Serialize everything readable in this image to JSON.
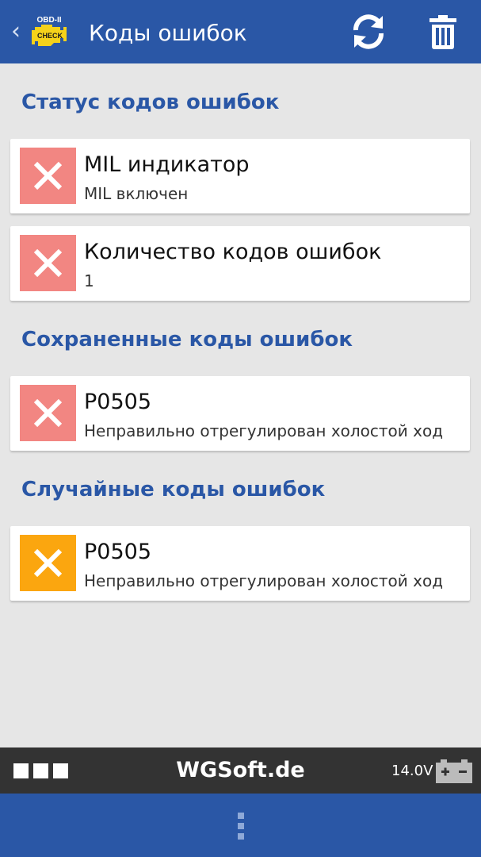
{
  "appbar": {
    "back_glyph": "‹",
    "logo_text_top": "OBD-II",
    "logo_text_bottom": "CHECK",
    "title": "Коды ошибок",
    "refresh_icon": "refresh-icon",
    "delete_icon": "trash-icon"
  },
  "sections": [
    {
      "title": "Статус кодов ошибок",
      "items": [
        {
          "title": "MIL индикатор",
          "subtitle": "MIL включен",
          "status_color": "#f28682"
        },
        {
          "title": "Количество кодов ошибок",
          "subtitle": "1",
          "status_color": "#f28682"
        }
      ]
    },
    {
      "title": "Сохраненные коды ошибок",
      "items": [
        {
          "title": "P0505",
          "subtitle": "Неправильно отрегулирован холостой ход",
          "status_color": "#f28682"
        }
      ]
    },
    {
      "title": "Случайные коды ошибок",
      "items": [
        {
          "title": "P0505",
          "subtitle": "Неправильно отрегулирован холостой ход",
          "status_color": "#fba60f"
        }
      ]
    }
  ],
  "statusbar": {
    "brand": "WGSoft.de",
    "voltage": "14.0V",
    "battery_icon": "battery-icon"
  },
  "navbar": {
    "menu_icon": "overflow-menu-icon"
  },
  "colors": {
    "primary": "#2a57a6",
    "background": "#e6e6e6",
    "error_red": "#f28682",
    "warning_orange": "#fba60f",
    "statusbar": "#333333"
  }
}
